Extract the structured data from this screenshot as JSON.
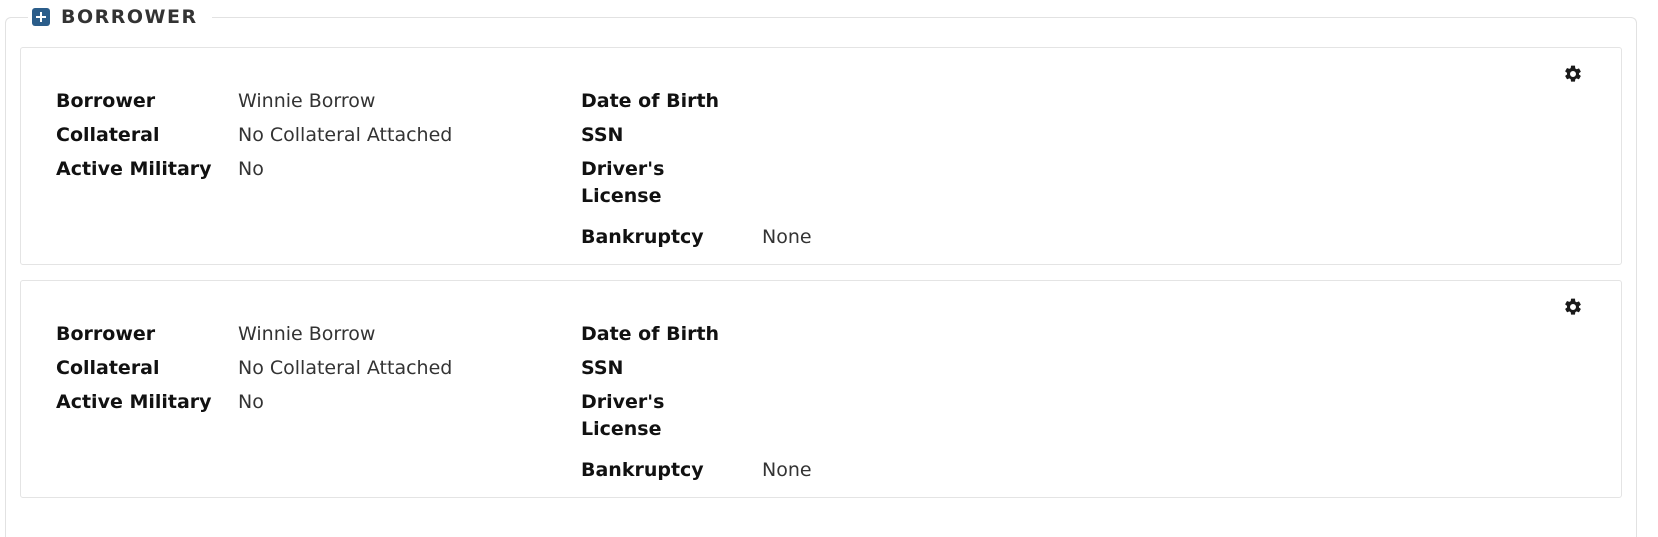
{
  "section": {
    "title": "BORROWER",
    "toggle_icon": "plus-square-icon"
  },
  "borrowers": [
    {
      "menu_icon": "gear-icon",
      "borrower_label": "Borrower",
      "borrower_value": "Winnie Borrow",
      "collateral_label": "Collateral",
      "collateral_value": "No Collateral Attached",
      "active_military_label": "Active Military",
      "active_military_value": "No",
      "dob_label": "Date of Birth",
      "dob_value": "",
      "ssn_label": "SSN",
      "ssn_value": "",
      "drivers_license_label": "Driver's License",
      "drivers_license_value": "",
      "bankruptcy_label": "Bankruptcy",
      "bankruptcy_value": "None"
    },
    {
      "menu_icon": "gear-icon",
      "borrower_label": "Borrower",
      "borrower_value": "Winnie Borrow",
      "collateral_label": "Collateral",
      "collateral_value": "No Collateral Attached",
      "active_military_label": "Active Military",
      "active_military_value": "No",
      "dob_label": "Date of Birth",
      "dob_value": "",
      "ssn_label": "SSN",
      "ssn_value": "",
      "drivers_license_label": "Driver's License",
      "drivers_license_value": "",
      "bankruptcy_label": "Bankruptcy",
      "bankruptcy_value": "None"
    }
  ],
  "colors": {
    "accent": "#2b5d8a",
    "border": "#e4e4e4"
  }
}
